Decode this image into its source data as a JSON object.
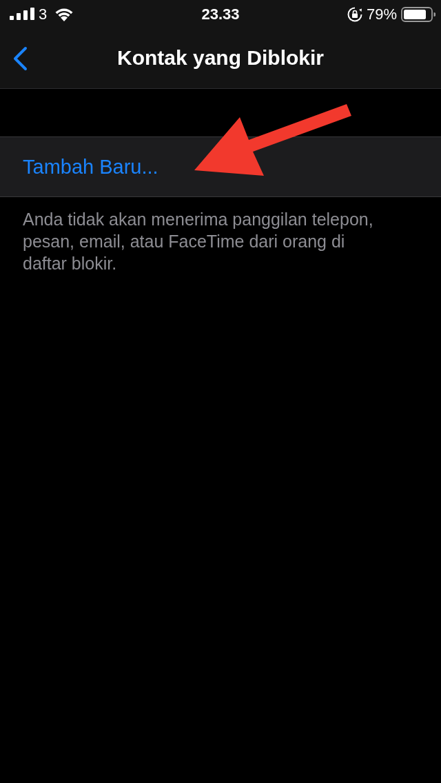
{
  "status_bar": {
    "carrier": "3",
    "time": "23.33",
    "battery": "79%"
  },
  "nav_bar": {
    "title": "Kontak yang Diblokir"
  },
  "list": {
    "items": [
      {
        "label": "Tambah Baru..."
      }
    ]
  },
  "footer": "Anda tidak akan menerima panggilan telepon, pesan, email, atau FaceTime dari orang di daftar blokir."
}
